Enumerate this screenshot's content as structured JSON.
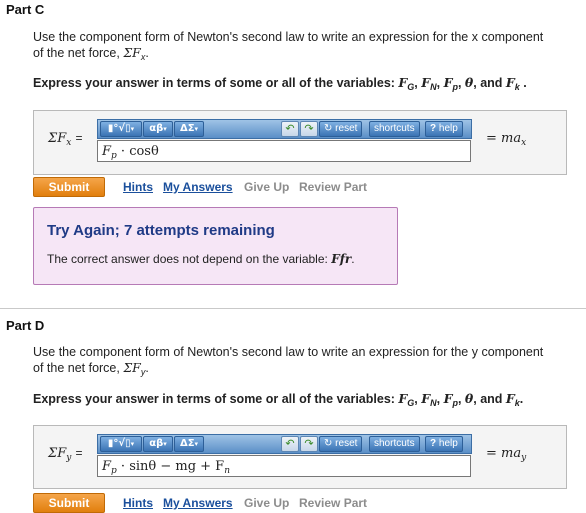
{
  "partC": {
    "title": "Part C",
    "question_line1": "Use the component form of Newton's second law to write an expression for the x component",
    "question_line2_prefix": "of the net force, ",
    "question_sym": "ΣF",
    "question_sub": "x",
    "question_end": ".",
    "express_prefix": "Express your answer in terms of some or all of the variables: ",
    "vars": [
      {
        "sym": "F",
        "sub": "G",
        "after": ", "
      },
      {
        "sym": "F",
        "sub": "N",
        "after": ", "
      },
      {
        "sym": "F",
        "sub": "p",
        "after": ", "
      },
      {
        "sym": "θ",
        "sub": "",
        "after": ", and "
      },
      {
        "sym": "F",
        "sub": "k",
        "after": " ."
      }
    ],
    "lhs_sym": "ΣF",
    "lhs_sub": "x",
    "lhs_eq": "=",
    "answer_expr": "F",
    "answer_sub": "p",
    "answer_rest": " · cosθ",
    "rhs_main": "= ma",
    "rhs_sub": "x",
    "submit_label": "Submit",
    "links": [
      "Hints",
      "My Answers",
      "Give Up",
      "Review Part"
    ],
    "feedback_title": "Try Again; 7 attempts remaining",
    "feedback_msg_prefix": "The correct answer does not depend on the variable: ",
    "feedback_var": "Ffr",
    "feedback_end": "."
  },
  "partD": {
    "title": "Part D",
    "question_line1": "Use the component form of Newton's second law to write an expression for the y component",
    "question_line2_prefix": "of the net force, ",
    "question_sym": "ΣF",
    "question_sub": "y",
    "question_end": ".",
    "express_prefix": "Express your answer in terms of some or all of the variables: ",
    "vars": [
      {
        "sym": "F",
        "sub": "G",
        "after": ", "
      },
      {
        "sym": "F",
        "sub": "N",
        "after": ", "
      },
      {
        "sym": "F",
        "sub": "p",
        "after": ", "
      },
      {
        "sym": "θ",
        "sub": "",
        "after": ", and "
      },
      {
        "sym": "F",
        "sub": "k",
        "after": "."
      }
    ],
    "lhs_sym": "ΣF",
    "lhs_sub": "y",
    "lhs_eq": "=",
    "answer_expr": "F",
    "answer_sub": "p",
    "answer_rest": " · sinθ − mg + F",
    "answer_sub2": "n",
    "rhs_main": "= ma",
    "rhs_sub": "y",
    "submit_label": "Submit",
    "links": [
      "Hints",
      "My Answers",
      "Give Up",
      "Review Part"
    ]
  },
  "toolbar": {
    "templates_label": "▮°√▯",
    "greek_label": "αβ",
    "delta_label": "ΔΣ",
    "undo_icon": "↶",
    "redo_icon": "↷",
    "reset_label": "reset",
    "shortcuts_label": "shortcuts",
    "help_label": "help",
    "help_q": "?",
    "reset_symbol": "↻"
  }
}
